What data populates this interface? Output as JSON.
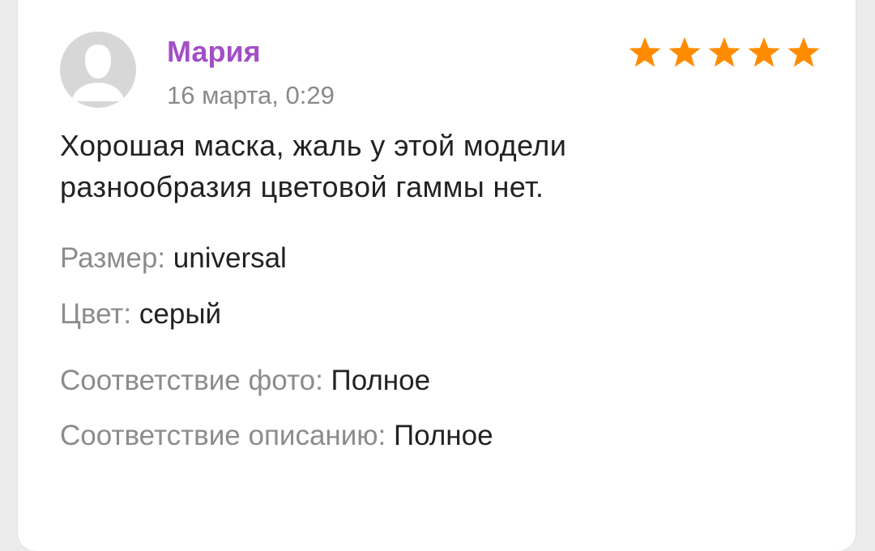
{
  "review": {
    "author": "Мария",
    "date": "16 марта, 0:29",
    "rating": 5,
    "rating_max": 5,
    "text_line1": "Хорошая маска, жаль у этой модели",
    "text_line2": "разнообразия цветовой гаммы нет.",
    "size_label": "Размер:",
    "size_value": "universal",
    "color_label": "Цвет:",
    "color_value": "серый",
    "photo_match_label": "Соответствие фото:",
    "photo_match_value": "Полное",
    "description_match_label": "Соответствие описанию:",
    "description_match_value": "Полное"
  },
  "colors": {
    "author": "#a24fc6",
    "star": "#ff8c00",
    "avatar_bg": "#d7d7d7",
    "avatar_fg": "#ffffff"
  },
  "icons": {
    "avatar": "user-silhouette-icon",
    "star": "star-icon"
  }
}
